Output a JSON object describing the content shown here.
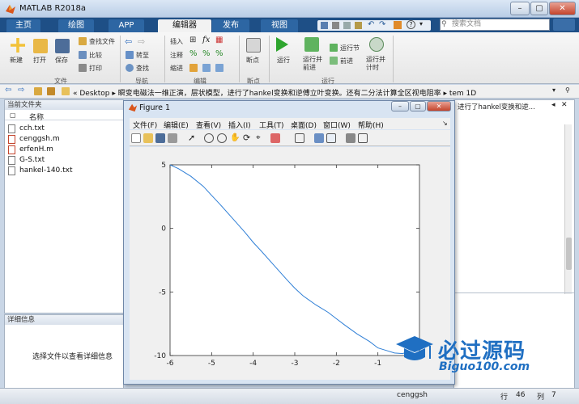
{
  "window": {
    "title": "MATLAB R2018a"
  },
  "tabs": [
    {
      "label": "主页",
      "active": false
    },
    {
      "label": "绘图",
      "active": false
    },
    {
      "label": "APP",
      "active": false
    },
    {
      "label": "编辑器",
      "active": true
    },
    {
      "label": "发布",
      "active": false
    },
    {
      "label": "视图",
      "active": false
    }
  ],
  "search": {
    "placeholder": "搜索文档"
  },
  "ribbon": {
    "file_group": {
      "label": "文件",
      "new": "新建",
      "open": "打开",
      "save": "保存",
      "find_files": "查找文件",
      "compare": "比较",
      "print": "打印"
    },
    "nav_group": {
      "label": "导航",
      "goto": "转至",
      "find": "查找"
    },
    "edit_group": {
      "label": "编辑",
      "insert": "插入",
      "comment": "注释",
      "indent": "缩进"
    },
    "breakpoint_group": {
      "label": "断点",
      "breakpoints": "断点"
    },
    "run_group": {
      "label": "运行",
      "run": "运行",
      "run_advance": "运行并\n前进",
      "run_section": "运行节",
      "advance": "前进",
      "run_time": "运行并\n计时"
    }
  },
  "address": {
    "path": "« Desktop ▸ 瞬变电磁法一维正演，层状模型，进行了hankel变换和逆傅立叶变换。还有二分法计算全区视电阻率 ▸ tem 1D",
    "right_tab": "进行了hankel变换和逆..."
  },
  "file_panel": {
    "title": "当前文件夹",
    "column": "名称",
    "files": [
      "cch.txt",
      "cenggsh.m",
      "erfenH.m",
      "G-S.txt",
      "hankel-140.txt"
    ]
  },
  "detail_panel": {
    "title": "详细信息",
    "message": "选择文件以查看详细信息"
  },
  "figure": {
    "title": "Figure 1",
    "menu": [
      "文件(F)",
      "编辑(E)",
      "查看(V)",
      "插入(I)",
      "工具(T)",
      "桌面(D)",
      "窗口(W)",
      "帮助(H)"
    ]
  },
  "chart_data": {
    "type": "line",
    "title": "",
    "xlabel": "",
    "ylabel": "",
    "xlim": [
      -6,
      0
    ],
    "ylim": [
      -10,
      5
    ],
    "xticks": [
      "-6",
      "-5",
      "-4",
      "-3",
      "-2",
      "-1"
    ],
    "yticks": [
      "5",
      "0",
      "-5",
      "-10"
    ],
    "series": [
      {
        "color": "#2f7fd6",
        "x": [
          -6,
          -5.8,
          -5.5,
          -5.2,
          -5.0,
          -4.8,
          -4.5,
          -4.2,
          -4.0,
          -3.8,
          -3.5,
          -3.2,
          -3.0,
          -2.8,
          -2.5,
          -2.2,
          -2.0,
          -1.8,
          -1.5,
          -1.2,
          -1.0,
          -0.8,
          -0.6,
          -0.4,
          -0.3,
          -0.15,
          0
        ],
        "y": [
          5,
          4.7,
          4.1,
          3.3,
          2.6,
          1.9,
          0.8,
          -0.3,
          -1.1,
          -1.8,
          -2.9,
          -4.0,
          -4.7,
          -5.3,
          -6.0,
          -6.6,
          -7.1,
          -7.6,
          -8.3,
          -8.9,
          -9.4,
          -9.6,
          -9.8,
          -9.85,
          -9.7,
          -9.9,
          -10
        ]
      }
    ]
  },
  "watermark": {
    "brand": "必过源码",
    "url": "Biguo100.com"
  },
  "status": {
    "file": "cenggsh",
    "row_label": "行",
    "row": "46",
    "col_label": "列",
    "col": "7"
  }
}
